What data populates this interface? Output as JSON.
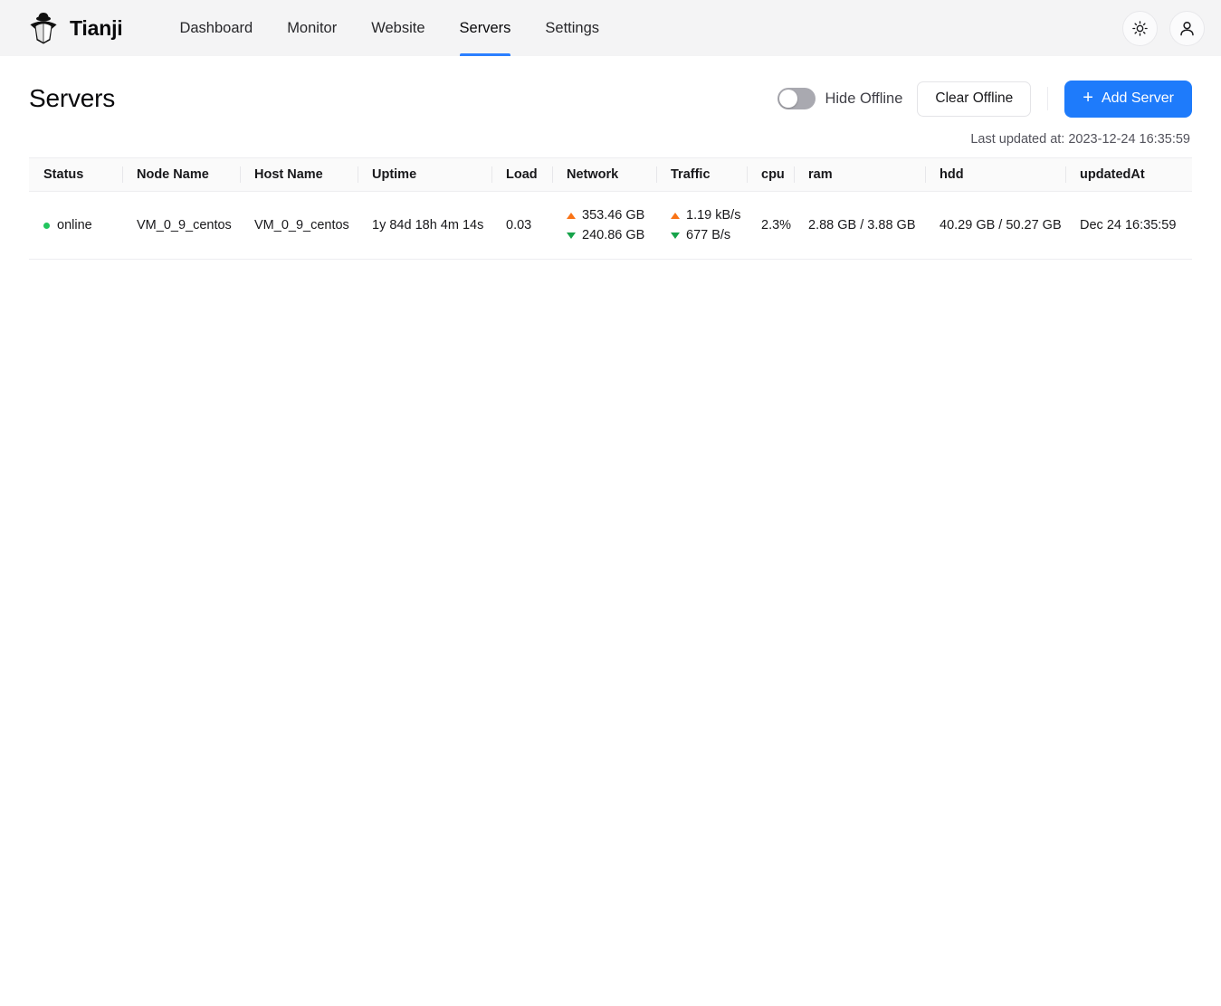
{
  "navbar": {
    "brand": "Tianji",
    "logo_icon": "spy-agent-logo-icon",
    "links": [
      {
        "label": "Dashboard",
        "active": false
      },
      {
        "label": "Monitor",
        "active": false
      },
      {
        "label": "Website",
        "active": false
      },
      {
        "label": "Servers",
        "active": true
      },
      {
        "label": "Settings",
        "active": false
      }
    ],
    "theme_toggle_icon": "sun-icon",
    "account_icon": "user-icon"
  },
  "page": {
    "title": "Servers",
    "hide_offline_label": "Hide Offline",
    "hide_offline_checked": false,
    "clear_offline_label": "Clear Offline",
    "add_server_label": "Add Server",
    "add_server_icon": "plus-icon",
    "last_updated": "Last updated at: 2023-12-24 16:35:59",
    "accent_color": "#1e7bfb"
  },
  "table": {
    "columns": [
      "Status",
      "Node Name",
      "Host Name",
      "Uptime",
      "Load",
      "Network",
      "Traffic",
      "cpu",
      "ram",
      "hdd",
      "updatedAt"
    ],
    "rows": [
      {
        "status": "online",
        "status_color": "#22c55e",
        "node_name": "VM_0_9_centos",
        "host_name": "VM_0_9_centos",
        "uptime": "1y 84d 18h 4m 14s",
        "load": "0.03",
        "network_up": "353.46 GB",
        "network_down": "240.86 GB",
        "traffic_up": "1.19 kB/s",
        "traffic_down": "677 B/s",
        "cpu": "2.3%",
        "ram": "2.88 GB / 3.88 GB",
        "hdd": "40.29 GB / 50.27 GB",
        "updated_at": "Dec 24 16:35:59"
      }
    ]
  }
}
